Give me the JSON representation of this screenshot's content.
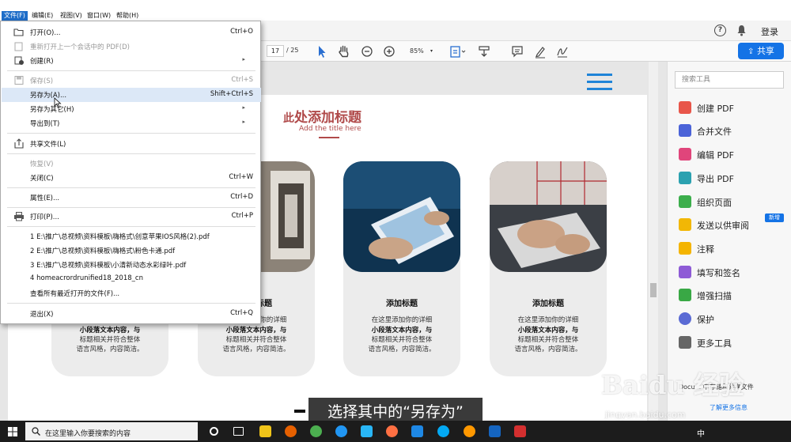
{
  "menubar": {
    "items": [
      "文件(F)",
      "编辑(E)",
      "视图(V)",
      "窗口(W)",
      "帮助(H)"
    ]
  },
  "header": {
    "help": "?",
    "login": "登录",
    "share": "共享"
  },
  "toolbar": {
    "page_current": "17",
    "page_total": "/ 25",
    "zoom": "85%"
  },
  "file_menu": {
    "items": [
      {
        "label": "打开(O)...",
        "shortcut": "Ctrl+O"
      },
      {
        "label": "重新打开上一个会话中的 PDF(D)",
        "shortcut": ""
      },
      {
        "label": "创建(R)",
        "shortcut": ""
      },
      {
        "label": "保存(S)",
        "shortcut": "Ctrl+S"
      },
      {
        "label": "另存为(A)...",
        "shortcut": "Shift+Ctrl+S"
      },
      {
        "label": "另存为其它(H)",
        "shortcut": ""
      },
      {
        "label": "导出到(T)",
        "shortcut": ""
      },
      {
        "label": "共享文件(L)",
        "shortcut": ""
      },
      {
        "label": "恢复(V)",
        "shortcut": ""
      },
      {
        "label": "关闭(C)",
        "shortcut": "Ctrl+W"
      },
      {
        "label": "属性(E)...",
        "shortcut": "Ctrl+D"
      },
      {
        "label": "打印(P)...",
        "shortcut": "Ctrl+P"
      },
      {
        "label": "1 E:\\推广\\总视频\\资料模板\\嗨格式\\创意苹果IOS风格(2).pdf",
        "shortcut": ""
      },
      {
        "label": "2 E:\\推广\\总视频\\资料模板\\嗨格式\\粉色卡通.pdf",
        "shortcut": ""
      },
      {
        "label": "3 E:\\推广\\总视频\\资料模板\\小清新动态水彩绿叶.pdf",
        "shortcut": ""
      },
      {
        "label": "4 homeacrordrunified18_2018_cn",
        "shortcut": ""
      },
      {
        "label": "查看所有最近打开的文件(F)...",
        "shortcut": ""
      },
      {
        "label": "退出(X)",
        "shortcut": "Ctrl+Q"
      }
    ]
  },
  "slide": {
    "title_first": "此",
    "title_rest": "处添加标题",
    "subtitle": "Add the title here",
    "cards": [
      {
        "title": "",
        "lines": [
          "",
          "小段落文本内容，与",
          "标题相关并符合整体",
          "语言风格，内容简洁。"
        ]
      },
      {
        "title": "添加标题",
        "lines": [
          "在这里添加你的详细",
          "小段落文本内容，与",
          "标题相关并符合整体",
          "语言风格，内容简洁。"
        ]
      },
      {
        "title": "添加标题",
        "lines": [
          "在这里添加你的详细",
          "小段落文本内容，与",
          "标题相关并符合整体",
          "语言风格，内容简洁。"
        ]
      },
      {
        "title": "添加标题",
        "lines": [
          "在这里添加你的详细",
          "小段落文本内容，与",
          "标题相关并符合整体",
          "语言风格，内容简洁。"
        ]
      }
    ]
  },
  "right_panel": {
    "search_placeholder": "搜索工具",
    "tools": [
      "创建 PDF",
      "合并文件",
      "编辑 PDF",
      "导出 PDF",
      "组织页面",
      "发送以供审阅",
      "注释",
      "填写和签名",
      "增强扫描",
      "保护",
      "更多工具"
    ],
    "new_badge": "新增",
    "note": "Docu... 中存储和共享文件",
    "link": "了解更多信息"
  },
  "caption": "选择其中的“另存为”",
  "watermark": {
    "text": "Baidu 经验",
    "sub": "jingyan.baidu.com"
  },
  "taskbar": {
    "search_text": "在这里输入你要搜索的内容",
    "ime": "中",
    "time": "",
    "date": ""
  },
  "colors": {
    "accent": "#1473e6",
    "menu_highlight": "#dce8f7",
    "title_red": "#b04a4a",
    "taskbar": "#1c1c1c"
  }
}
